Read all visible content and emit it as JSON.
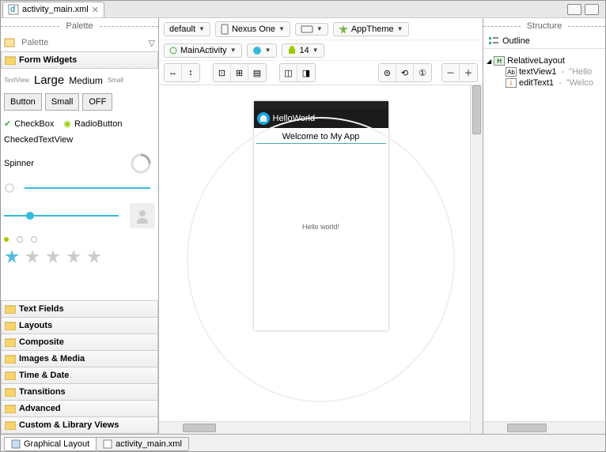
{
  "tab": {
    "filename": "activity_main.xml"
  },
  "palette": {
    "title": "Palette",
    "search_placeholder": "Palette",
    "drawers": {
      "form_widgets": "Form Widgets",
      "text_fields": "Text Fields",
      "layouts": "Layouts",
      "composite": "Composite",
      "images_media": "Images & Media",
      "time_date": "Time & Date",
      "transitions": "Transitions",
      "advanced": "Advanced",
      "custom_library": "Custom & Library Views"
    },
    "widgets": {
      "textview_tiny": "TextView",
      "large": "Large",
      "medium": "Medium",
      "small_text": "Small",
      "button": "Button",
      "small": "Small",
      "off": "OFF",
      "checkbox": "CheckBox",
      "radio": "RadioButton",
      "checked_tv": "CheckedTextView",
      "spinner": "Spinner",
      "off2": "OFF"
    }
  },
  "config": {
    "dropdown": "default",
    "device": "Nexus One",
    "theme": "AppTheme",
    "activity": "MainActivity",
    "api": "14"
  },
  "preview": {
    "app_title": "HelloWorld",
    "edit_text": "Welcome to My App",
    "hello": "Hello world!"
  },
  "outline": {
    "title": "Structure",
    "tab": "Outline",
    "root": "RelativeLayout",
    "child1_name": "textView1",
    "child1_val": "\"Hello",
    "child2_name": "editText1",
    "child2_val": "\"Welco"
  },
  "bottom": {
    "graphical": "Graphical Layout",
    "xml": "activity_main.xml"
  },
  "colors": {
    "accent": "#1BA5E0"
  }
}
